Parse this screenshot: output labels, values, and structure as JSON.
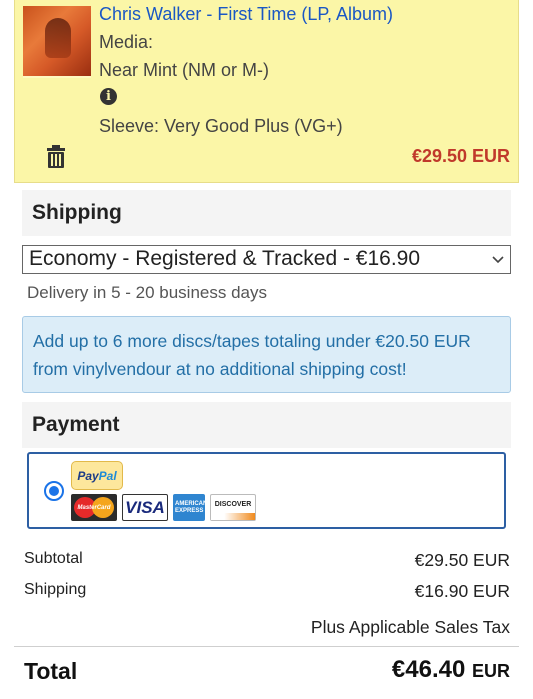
{
  "cart_item": {
    "title": "Chris Walker - First Time (LP, Album)",
    "media_label": "Media:",
    "media_condition": "Near Mint (NM or M-)",
    "sleeve": "Sleeve: Very Good Plus (VG+)",
    "price": "€29.50 EUR",
    "icons": [
      "info-icon",
      "trash-icon"
    ]
  },
  "shipping": {
    "heading": "Shipping",
    "selected_option": "Economy - Registered & Tracked - €16.90",
    "delivery": "Delivery in 5 - 20 business days",
    "notice": "Add up to 6 more discs/tapes totaling under €20.50 EUR from vinylvendour at no additional shipping cost!"
  },
  "payment": {
    "heading": "Payment",
    "selected": true,
    "methods": {
      "paypal_a": "Pay",
      "paypal_b": "Pal",
      "mastercard": "MasterCard",
      "visa": "VISA",
      "amex": "AMERICAN EXPRESS",
      "discover": "DISCOVER"
    }
  },
  "summary": {
    "subtotal_label": "Subtotal",
    "subtotal_value": "€29.50 EUR",
    "shipping_label": "Shipping",
    "shipping_value": "€16.90 EUR",
    "tax_note": "Plus Applicable Sales Tax",
    "total_label": "Total",
    "total_amount": "€46.40",
    "total_currency": "EUR"
  },
  "colors": {
    "item_bg": "#fbf6a7",
    "link": "#1a57c4",
    "price": "#c0392b",
    "notice_bg": "#dcedf8",
    "notice_text": "#236fa6",
    "payment_border": "#2d5fa3"
  }
}
